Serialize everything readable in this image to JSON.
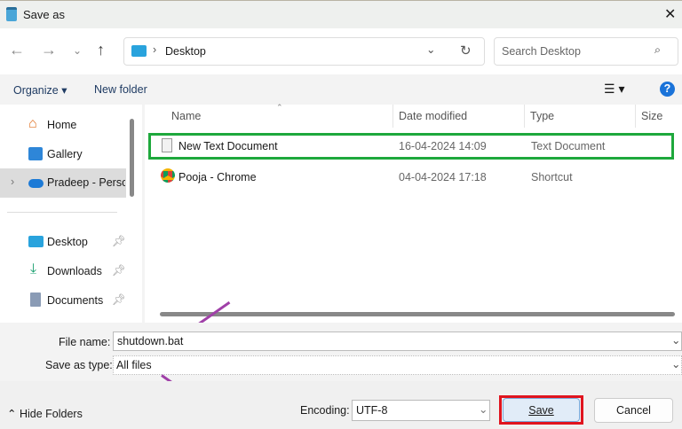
{
  "window": {
    "title": "Save as",
    "close_icon": "close-icon"
  },
  "nav": {
    "breadcrumb": "Desktop",
    "search_placeholder": "Search Desktop"
  },
  "toolbar": {
    "organize": "Organize",
    "new_folder": "New folder"
  },
  "sidebar": {
    "items": [
      {
        "label": "Home",
        "icon": "home-icon"
      },
      {
        "label": "Gallery",
        "icon": "gallery-icon"
      },
      {
        "label": "Pradeep - Personal",
        "icon": "onedrive-icon"
      },
      {
        "label": "Desktop",
        "icon": "desktop-icon"
      },
      {
        "label": "Downloads",
        "icon": "download-icon"
      },
      {
        "label": "Documents",
        "icon": "documents-icon"
      }
    ]
  },
  "columns": [
    "Name",
    "Date modified",
    "Type",
    "Size"
  ],
  "files": [
    {
      "name": "New Text Document",
      "date": "16-04-2024 14:09",
      "type": "Text Document",
      "highlight": "#1ea83c"
    },
    {
      "name": "Pooja - Chrome",
      "date": "04-04-2024 17:18",
      "type": "Shortcut"
    }
  ],
  "form": {
    "file_name_label": "File name:",
    "file_name": "shutdown.bat",
    "type_label": "Save as type:",
    "type_value": "All files"
  },
  "footer": {
    "hide_folders": "Hide Folders",
    "encoding_label": "Encoding:",
    "encoding": "UTF-8",
    "save": "Save",
    "cancel": "Cancel",
    "save_highlight": "#e0141e"
  },
  "annotation_color": "#a040a8"
}
